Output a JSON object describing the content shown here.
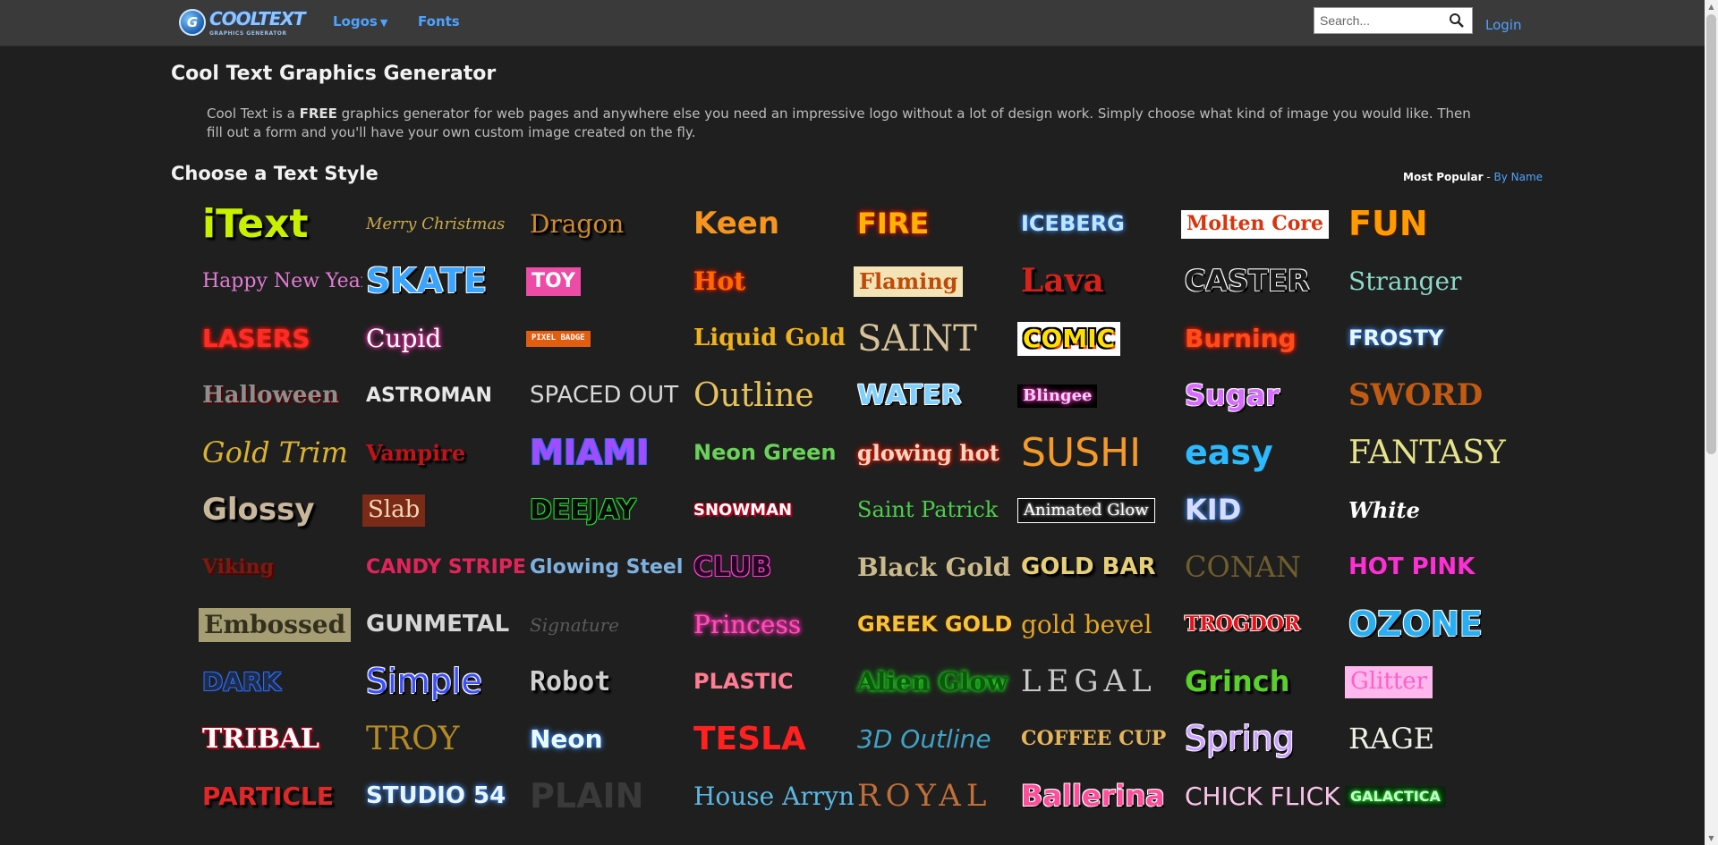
{
  "header": {
    "logo_main": "COOLTEXT",
    "logo_sub": "GRAPHICS GENERATOR",
    "logo_mark": "G",
    "nav": [
      {
        "label": "Logos"
      },
      {
        "label": "Fonts"
      }
    ],
    "caret": "▼",
    "search_placeholder": "Search...",
    "login": "Login"
  },
  "page": {
    "title": "Cool Text Graphics Generator",
    "intro_before": "Cool Text is a ",
    "intro_bold": "FREE",
    "intro_after": " graphics generator for web pages and anywhere else you need an impressive logo without a lot of design work. Simply choose what kind of image you would like. Then fill out a form and you'll have your own custom image created on the fly.",
    "section_title": "Choose a Text Style",
    "sort_active": "Most Popular",
    "sort_sep": " - ",
    "sort_other": "By Name"
  },
  "styles": [
    {
      "label": "iText",
      "fg": "#c8f000",
      "bg": "",
      "fs": 44,
      "ff": "sans",
      "w": "bold",
      "fx": "shadow-dark"
    },
    {
      "label": "Merry Christmas",
      "fg": "#c9a94a",
      "bg": "",
      "fs": 18,
      "ff": "serif",
      "w": "normal",
      "fx": "italic"
    },
    {
      "label": "Dragon",
      "fg": "#d08a2a",
      "bg": "",
      "fs": 28,
      "ff": "serif",
      "w": "normal",
      "fx": "shadow-dark"
    },
    {
      "label": "Keen",
      "fg": "#f7951e",
      "bg": "",
      "fs": 34,
      "ff": "sans",
      "w": "bold",
      "fx": "none"
    },
    {
      "label": "FIRE",
      "fg": "#ffb300",
      "bg": "",
      "fs": 32,
      "ff": "sans",
      "w": "bold",
      "fx": "glow-red"
    },
    {
      "label": "ICEBERG",
      "fg": "#bfe6ff",
      "bg": "",
      "fs": 24,
      "ff": "sans",
      "w": "bold",
      "fx": "glow-blue"
    },
    {
      "label": "Molten Core",
      "fg": "#d9340e",
      "bg": "#ffffff",
      "fs": 22,
      "ff": "serif",
      "w": "bold",
      "fx": "none"
    },
    {
      "label": "FUN",
      "fg": "#ff9a00",
      "bg": "",
      "fs": 38,
      "ff": "sans",
      "w": "bold",
      "fx": "outline-dark"
    },
    {
      "label": "Happy New Year",
      "fg": "#e27bd4",
      "bg": "",
      "fs": 22,
      "ff": "serif",
      "w": "normal",
      "fx": "none"
    },
    {
      "label": "SKATE",
      "fg": "#3aa5ff",
      "bg": "",
      "fs": 38,
      "ff": "sans",
      "w": "bold",
      "fx": "outline-white"
    },
    {
      "label": "TOY",
      "fg": "#ffffff",
      "bg": "#ee4ba6",
      "fs": 22,
      "ff": "sans",
      "w": "bold",
      "fx": "none"
    },
    {
      "label": "Hot",
      "fg": "#ff6a00",
      "bg": "",
      "fs": 28,
      "ff": "serif",
      "w": "bold",
      "fx": "glow-red"
    },
    {
      "label": "Flaming",
      "fg": "#c04a0a",
      "bg": "#f4e3b4",
      "fs": 24,
      "ff": "serif",
      "w": "bold",
      "fx": "none"
    },
    {
      "label": "Lava",
      "fg": "#d5231c",
      "bg": "",
      "fs": 36,
      "ff": "serif",
      "w": "bold",
      "fx": "shadow-dark"
    },
    {
      "label": "CASTER",
      "fg": "#1a1a1a",
      "bg": "",
      "fs": 32,
      "ff": "sans",
      "w": "bold",
      "fx": "outline-white"
    },
    {
      "label": "Stranger",
      "fg": "#8cd8c7",
      "bg": "",
      "fs": 28,
      "ff": "serif",
      "w": "normal",
      "fx": "none"
    },
    {
      "label": "LASERS",
      "fg": "#ff2b2b",
      "bg": "",
      "fs": 28,
      "ff": "sans",
      "w": "bold",
      "fx": "glow-red"
    },
    {
      "label": "Cupid",
      "fg": "#ffffff",
      "bg": "",
      "fs": 28,
      "ff": "serif",
      "w": "normal",
      "fx": "glow-pink"
    },
    {
      "label": "PIXEL BADGE",
      "fg": "#ffffff",
      "bg": "#e35d11",
      "fs": 9,
      "ff": "mono",
      "w": "bold",
      "fx": "none"
    },
    {
      "label": "Liquid Gold",
      "fg": "#f0b21a",
      "bg": "",
      "fs": 26,
      "ff": "serif",
      "w": "bold",
      "fx": "none"
    },
    {
      "label": "SAINT",
      "fg": "#d7c39a",
      "bg": "",
      "fs": 40,
      "ff": "serif",
      "w": "normal",
      "fx": "none"
    },
    {
      "label": "COMIC",
      "fg": "#ffe000",
      "bg": "#ffffff",
      "fs": 28,
      "ff": "sans",
      "w": "bold",
      "fx": "comic"
    },
    {
      "label": "Burning",
      "fg": "#ff4c1a",
      "bg": "",
      "fs": 28,
      "ff": "sans",
      "w": "bold",
      "fx": "glow-red"
    },
    {
      "label": "FROSTY",
      "fg": "#e7f7ff",
      "bg": "",
      "fs": 24,
      "ff": "sans",
      "w": "bold",
      "fx": "glow-blue"
    },
    {
      "label": "Halloween",
      "fg": "#8e8e8e",
      "bg": "",
      "fs": 26,
      "ff": "serif",
      "w": "bold",
      "fx": "shadow-red"
    },
    {
      "label": "ASTROMAN",
      "fg": "#e8e8e8",
      "bg": "",
      "fs": 22,
      "ff": "sans",
      "w": "bold",
      "fx": "none"
    },
    {
      "label": "SPACED OUT",
      "fg": "#d8d8d8",
      "bg": "",
      "fs": 26,
      "ff": "sans",
      "w": "normal",
      "fx": "none"
    },
    {
      "label": "Outline",
      "fg": "#e5c25b",
      "bg": "",
      "fs": 36,
      "ff": "serif",
      "w": "normal",
      "fx": "none"
    },
    {
      "label": "WATER",
      "fg": "#7fd0ff",
      "bg": "",
      "fs": 30,
      "ff": "sans",
      "w": "bold",
      "fx": "outline-white"
    },
    {
      "label": "Blingee",
      "fg": "#e9d2ff",
      "bg": "#000000",
      "fs": 18,
      "ff": "serif",
      "w": "bold",
      "fx": "glow-pink"
    },
    {
      "label": "Sugar",
      "fg": "#d86cff",
      "bg": "",
      "fs": 32,
      "ff": "sans",
      "w": "bold",
      "fx": "outline-white"
    },
    {
      "label": "SWORD",
      "fg": "#c25b12",
      "bg": "",
      "fs": 34,
      "ff": "serif",
      "w": "bold",
      "fx": "none"
    },
    {
      "label": "Gold Trim",
      "fg": "#d9b233",
      "bg": "",
      "fs": 32,
      "ff": "serif",
      "w": "normal",
      "fx": "italic"
    },
    {
      "label": "Vampire",
      "fg": "#c2121a",
      "bg": "",
      "fs": 24,
      "ff": "serif",
      "w": "bold",
      "fx": "shadow-dark"
    },
    {
      "label": "MIAMI",
      "fg": "#a14dff",
      "bg": "",
      "fs": 38,
      "ff": "sans",
      "w": "bold",
      "fx": "outline-blue"
    },
    {
      "label": "Neon Green",
      "fg": "#6ad25a",
      "bg": "",
      "fs": 24,
      "ff": "sans",
      "w": "bold",
      "fx": "none"
    },
    {
      "label": "glowing hot",
      "fg": "#ffd5c4",
      "bg": "",
      "fs": 24,
      "ff": "serif",
      "w": "bold",
      "fx": "glow-red"
    },
    {
      "label": "SUSHI",
      "fg": "#f59a28",
      "bg": "",
      "fs": 44,
      "ff": "sans",
      "w": "normal",
      "fx": "none"
    },
    {
      "label": "easy",
      "fg": "#2bb9ff",
      "bg": "",
      "fs": 38,
      "ff": "sans",
      "w": "bold",
      "fx": "none"
    },
    {
      "label": "FANTASY",
      "fg": "#e6e38a",
      "bg": "",
      "fs": 36,
      "ff": "serif",
      "w": "normal",
      "fx": "none"
    },
    {
      "label": "Glossy",
      "fg": "#c9b79c",
      "bg": "",
      "fs": 34,
      "ff": "sans",
      "w": "bold",
      "fx": "shadow-dark"
    },
    {
      "label": "Slab",
      "fg": "#f2d7b0",
      "bg": "#7a2a16",
      "fs": 26,
      "ff": "serif",
      "w": "normal",
      "fx": "none"
    },
    {
      "label": "DEEJAY",
      "fg": "#0a0a0a",
      "bg": "",
      "fs": 30,
      "ff": "sans",
      "w": "bold",
      "fx": "outline-green"
    },
    {
      "label": "SNOWMAN",
      "fg": "#ffffff",
      "bg": "",
      "fs": 18,
      "ff": "sans",
      "w": "bold",
      "fx": "outline-red"
    },
    {
      "label": "Saint Patrick",
      "fg": "#4ccf4c",
      "bg": "",
      "fs": 24,
      "ff": "serif",
      "w": "normal",
      "fx": "none"
    },
    {
      "label": "Animated Glow",
      "fg": "#ffffff",
      "bg": "#111111",
      "fs": 18,
      "ff": "serif",
      "w": "normal",
      "fx": "boxed"
    },
    {
      "label": "KID",
      "fg": "#d7dcff",
      "bg": "",
      "fs": 32,
      "ff": "sans",
      "w": "bold",
      "fx": "glow-blue"
    },
    {
      "label": "White",
      "fg": "#ffffff",
      "bg": "",
      "fs": 24,
      "ff": "serif",
      "w": "bold",
      "fx": "italic"
    },
    {
      "label": "Viking",
      "fg": "#7a1b11",
      "bg": "",
      "fs": 22,
      "ff": "serif",
      "w": "bold",
      "fx": "shadow-red"
    },
    {
      "label": "CANDY STRIPE",
      "fg": "#e2245a",
      "bg": "",
      "fs": 22,
      "ff": "sans",
      "w": "bold",
      "fx": "none"
    },
    {
      "label": "Glowing Steel",
      "fg": "#7fb1df",
      "bg": "",
      "fs": 22,
      "ff": "sans",
      "w": "bold",
      "fx": "none"
    },
    {
      "label": "CLUB",
      "fg": "#250423",
      "bg": "",
      "fs": 30,
      "ff": "sans",
      "w": "bold",
      "fx": "outline-pink"
    },
    {
      "label": "Black Gold",
      "fg": "#cab98a",
      "bg": "",
      "fs": 28,
      "ff": "serif",
      "w": "bold",
      "fx": "none"
    },
    {
      "label": "GOLD BAR",
      "fg": "#e7cf77",
      "bg": "",
      "fs": 26,
      "ff": "sans",
      "w": "bold",
      "fx": "shadow-dark"
    },
    {
      "label": "CONAN",
      "fg": "#6f5e2d",
      "bg": "",
      "fs": 32,
      "ff": "serif",
      "w": "normal",
      "fx": "none"
    },
    {
      "label": "HOT PINK",
      "fg": "#ff2fd5",
      "bg": "",
      "fs": 26,
      "ff": "sans",
      "w": "bold",
      "fx": "none"
    },
    {
      "label": "Embossed",
      "fg": "#33301e",
      "bg": "#a59d74",
      "fs": 28,
      "ff": "serif",
      "w": "bold",
      "fx": "none"
    },
    {
      "label": "GUNMETAL",
      "fg": "#d6d6d6",
      "bg": "",
      "fs": 26,
      "ff": "sans",
      "w": "bold",
      "fx": "none"
    },
    {
      "label": "Signature",
      "fg": "#5a5a5a",
      "bg": "",
      "fs": 20,
      "ff": "serif",
      "w": "normal",
      "fx": "italic"
    },
    {
      "label": "Princess",
      "fg": "#ff4fb8",
      "bg": "",
      "fs": 28,
      "ff": "serif",
      "w": "normal",
      "fx": "glow-pink"
    },
    {
      "label": "GREEK GOLD",
      "fg": "#f3c33a",
      "bg": "",
      "fs": 24,
      "ff": "sans",
      "w": "bold",
      "fx": "outline-dark"
    },
    {
      "label": "gold bevel",
      "fg": "#e4a524",
      "bg": "",
      "fs": 28,
      "ff": "serif",
      "w": "normal",
      "fx": "none"
    },
    {
      "label": "TROGDOR",
      "fg": "#e5141b",
      "bg": "",
      "fs": 22,
      "ff": "serif",
      "w": "bold",
      "fx": "outline-white"
    },
    {
      "label": "OZONE",
      "fg": "#2aaef2",
      "bg": "",
      "fs": 38,
      "ff": "sans",
      "w": "bold",
      "fx": "outline-white"
    },
    {
      "label": "DARK",
      "fg": "#1e2c46",
      "bg": "",
      "fs": 28,
      "ff": "sans",
      "w": "bold",
      "fx": "outline-blue"
    },
    {
      "label": "Simple",
      "fg": "#3a4fff",
      "bg": "",
      "fs": 38,
      "ff": "sans",
      "w": "normal",
      "fx": "outline-white"
    },
    {
      "label": "Robot",
      "fg": "#cfcfcf",
      "bg": "",
      "fs": 30,
      "ff": "mono",
      "w": "bold",
      "fx": "shadow-dark"
    },
    {
      "label": "PLASTIC",
      "fg": "#ff7c92",
      "bg": "",
      "fs": 24,
      "ff": "sans",
      "w": "bold",
      "fx": "none"
    },
    {
      "label": "Alien Glow",
      "fg": "#0a5c0a",
      "bg": "",
      "fs": 28,
      "ff": "serif",
      "w": "bold",
      "fx": "glow-green"
    },
    {
      "label": "LEGAL",
      "fg": "#c9c9c9",
      "bg": "",
      "fs": 34,
      "ff": "serif",
      "w": "normal",
      "fx": "spaced"
    },
    {
      "label": "Grinch",
      "fg": "#5ad12a",
      "bg": "",
      "fs": 32,
      "ff": "sans",
      "w": "bold",
      "fx": "shadow-dark"
    },
    {
      "label": "Glitter",
      "fg": "#ff60c6",
      "bg": "#ffb8ee",
      "fs": 26,
      "ff": "serif",
      "w": "normal",
      "fx": "none"
    },
    {
      "label": "TRIBAL",
      "fg": "#ffffff",
      "bg": "",
      "fs": 30,
      "ff": "serif",
      "w": "bold",
      "fx": "outline-red"
    },
    {
      "label": "TROY",
      "fg": "#b58a22",
      "bg": "",
      "fs": 36,
      "ff": "serif",
      "w": "normal",
      "fx": "none"
    },
    {
      "label": "Neon",
      "fg": "#e9fbff",
      "bg": "",
      "fs": 28,
      "ff": "sans",
      "w": "bold",
      "fx": "glow-blue"
    },
    {
      "label": "TESLA",
      "fg": "#ff2020",
      "bg": "",
      "fs": 36,
      "ff": "sans",
      "w": "bold",
      "fx": "none"
    },
    {
      "label": "3D Outline",
      "fg": "#3fa3c8",
      "bg": "",
      "fs": 28,
      "ff": "sans",
      "w": "normal",
      "fx": "italic"
    },
    {
      "label": "COFFEE CUP",
      "fg": "#e6b45a",
      "bg": "",
      "fs": 22,
      "ff": "serif",
      "w": "bold",
      "fx": "none"
    },
    {
      "label": "Spring",
      "fg": "#caa1ff",
      "bg": "",
      "fs": 38,
      "ff": "sans",
      "w": "normal",
      "fx": "outline-white"
    },
    {
      "label": "RAGE",
      "fg": "#eef0e6",
      "bg": "",
      "fs": 32,
      "ff": "serif",
      "w": "normal",
      "fx": "none"
    },
    {
      "label": "PARTICLE",
      "fg": "#e12727",
      "bg": "",
      "fs": 28,
      "ff": "sans",
      "w": "bold",
      "fx": "shadow-dark"
    },
    {
      "label": "STUDIO 54",
      "fg": "#e8f5ff",
      "bg": "",
      "fs": 26,
      "ff": "sans",
      "w": "bold",
      "fx": "glow-blue"
    },
    {
      "label": "PLAIN",
      "fg": "#3a3a3a",
      "bg": "",
      "fs": 38,
      "ff": "sans",
      "w": "bold",
      "fx": "none"
    },
    {
      "label": "House Arryn",
      "fg": "#5bb8e3",
      "bg": "",
      "fs": 28,
      "ff": "serif",
      "w": "normal",
      "fx": "none"
    },
    {
      "label": "ROYAL",
      "fg": "#c06f39",
      "bg": "",
      "fs": 34,
      "ff": "serif",
      "w": "normal",
      "fx": "spaced"
    },
    {
      "label": "Ballerina",
      "fg": "#ff4f9c",
      "bg": "",
      "fs": 32,
      "ff": "sans",
      "w": "bold",
      "fx": "outline-white"
    },
    {
      "label": "CHICK FLICK",
      "fg": "#fbc4ea",
      "bg": "",
      "fs": 28,
      "ff": "sans",
      "w": "normal",
      "fx": "none"
    },
    {
      "label": "GALACTICA",
      "fg": "#c4ffcf",
      "bg": "#0b2310",
      "fs": 16,
      "ff": "sans",
      "w": "bold",
      "fx": "glow-green"
    }
  ]
}
